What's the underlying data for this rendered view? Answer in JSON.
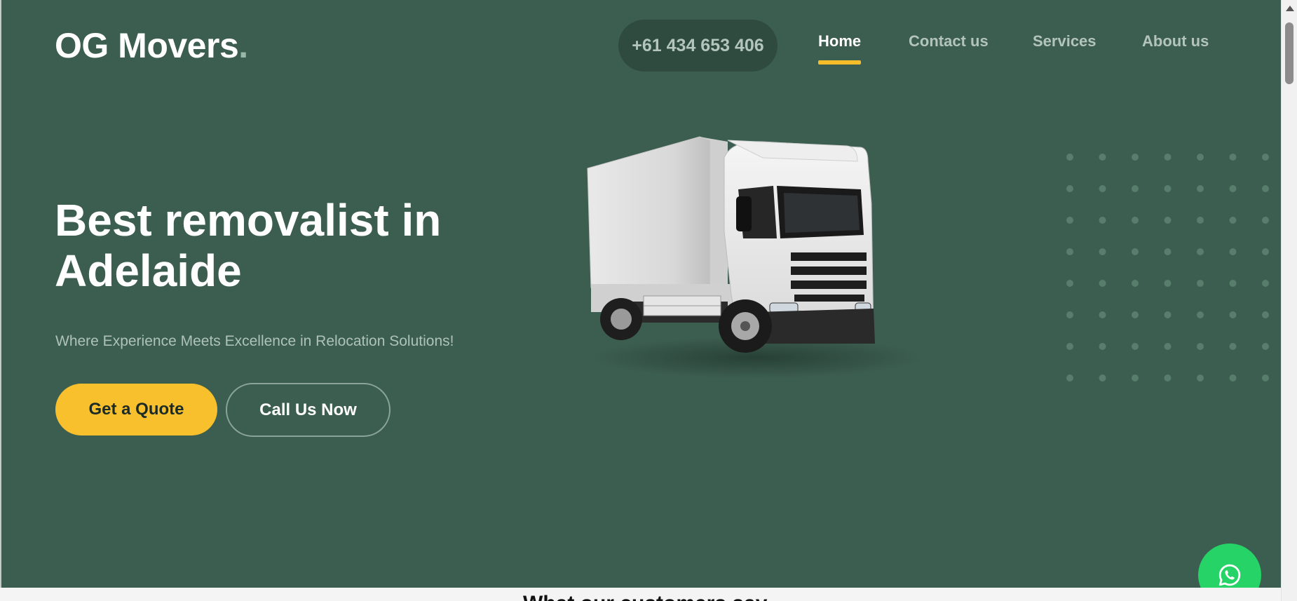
{
  "brand": {
    "name": "OG Movers",
    "dot": "."
  },
  "header": {
    "phone": "+61 434 653 406",
    "nav": [
      {
        "label": "Home",
        "active": true
      },
      {
        "label": "Contact us",
        "active": false
      },
      {
        "label": "Services",
        "active": false
      },
      {
        "label": "About us",
        "active": false
      }
    ]
  },
  "hero": {
    "headline_line1": "Best removalist in",
    "headline_line2": "Adelaide",
    "subline": "Where Experience Meets Excellence in Relocation Solutions!",
    "primary_button": "Get a Quote",
    "secondary_button": "Call Us Now"
  },
  "next_section": {
    "heading": "What our customers say"
  },
  "icons": {
    "chat": "whatsapp-icon",
    "illustration": "truck-image"
  },
  "colors": {
    "hero_bg": "#3c5e50",
    "accent": "#f6bd2b",
    "phone_pill": "#2f4a3f",
    "whatsapp": "#25d366"
  }
}
